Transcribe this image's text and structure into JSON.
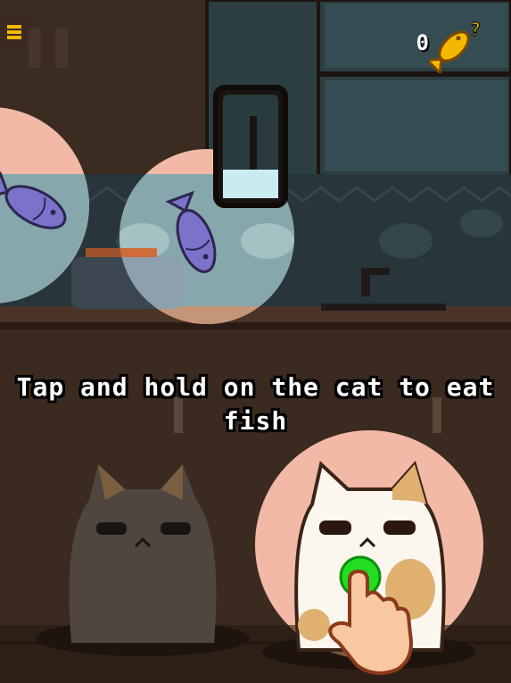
{
  "hud": {
    "menu_icon": "hamburger-menu-icon",
    "pause_icon": "pause-icon",
    "score": "0",
    "fish_icon": "golden-fish-icon",
    "fish_badge": "?"
  },
  "tutorial": {
    "instruction": "Tap and hold on the cat to eat fish",
    "hint_icon": "tap-hand-icon"
  },
  "fish_queue": {
    "count": 2,
    "color": "#7b73c9"
  },
  "colors": {
    "wall": "#3c2d22",
    "window_frame": "#2a1e16",
    "fish_tank": "#4a6a72",
    "spotlight": "#f2b9a6",
    "highlight_green": "#22dd22",
    "coin_gold": "#f5b800"
  }
}
